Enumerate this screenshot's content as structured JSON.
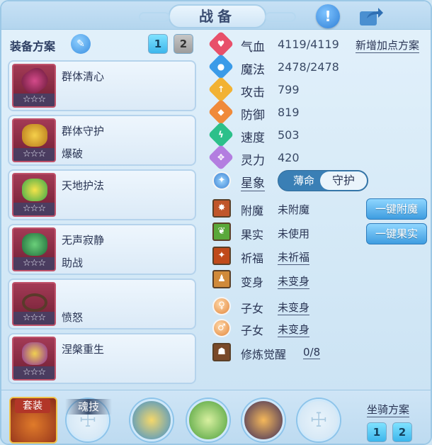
{
  "header": {
    "title": "战备",
    "info_icon": "exclamation-icon",
    "share_icon": "share-icon"
  },
  "equipment": {
    "title": "装备方案",
    "plans": [
      "1",
      "2"
    ],
    "active_plan": "1",
    "slots": [
      {
        "line1": "群体清心",
        "line2": "",
        "stars": "☆☆☆"
      },
      {
        "line1": "群体守护",
        "line2": "爆破",
        "stars": "☆☆☆"
      },
      {
        "line1": "天地护法",
        "line2": "",
        "stars": "☆☆☆"
      },
      {
        "line1": "无声寂静",
        "line2": "助战",
        "stars": "☆☆☆"
      },
      {
        "line1": "",
        "line2": "愤怒",
        "stars": "☆☆☆"
      },
      {
        "line1": "涅槃重生",
        "line2": "",
        "stars": "☆☆☆"
      }
    ]
  },
  "stats": {
    "add_points_link": "新增加点方案",
    "rows": [
      {
        "label": "气血",
        "value": "4119/4119",
        "color": "#e8506a",
        "icon": "heart-icon"
      },
      {
        "label": "魔法",
        "value": "2478/2478",
        "color": "#3b9be8",
        "icon": "mana-icon"
      },
      {
        "label": "攻击",
        "value": "799",
        "color": "#f2b233",
        "icon": "attack-icon"
      },
      {
        "label": "防御",
        "value": "819",
        "color": "#f08a3a",
        "icon": "defense-icon"
      },
      {
        "label": "速度",
        "value": "503",
        "color": "#2cc08a",
        "icon": "speed-icon"
      },
      {
        "label": "灵力",
        "value": "420",
        "color": "#b37ee0",
        "icon": "spirit-icon"
      }
    ],
    "star_label": "星象",
    "star_options": [
      "薄命",
      "守护"
    ],
    "star_selected": "守护"
  },
  "status": {
    "rows": [
      {
        "label": "附魔",
        "value": "未附魔",
        "underlined": false
      },
      {
        "label": "果实",
        "value": "未使用",
        "underlined": false
      },
      {
        "label": "祈福",
        "value": "未祈福",
        "underlined": true
      },
      {
        "label": "变身",
        "value": "未变身",
        "underlined": true
      },
      {
        "label": "子女",
        "value": "未变身",
        "underlined": true
      },
      {
        "label": "子女",
        "value": "未变身",
        "underlined": true
      },
      {
        "label": "修炼觉醒",
        "value": "0/8",
        "underlined": true
      }
    ],
    "buttons": [
      "一键附魔",
      "一键果实"
    ]
  },
  "bottom": {
    "suit_label": "套装",
    "soul_label": "魂技",
    "mount_title": "坐骑方案",
    "mount_plans": [
      "1",
      "2"
    ]
  }
}
